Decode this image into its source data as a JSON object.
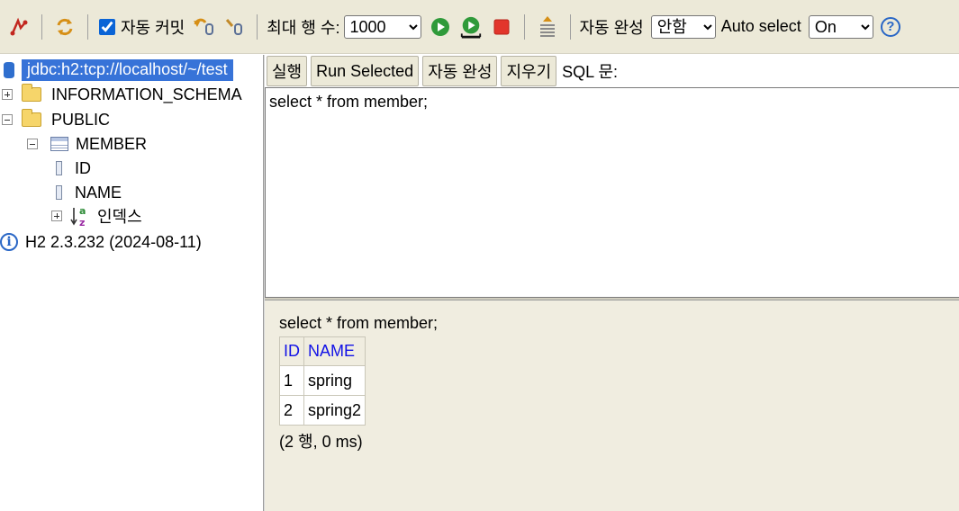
{
  "toolbar": {
    "autocommit_label": "자동 커밋",
    "autocommit_checked": true,
    "max_rows_label": "최대 행 수:",
    "max_rows_value": "1000",
    "autocomplete_label": "자동 완성",
    "autocomplete_value": "안함",
    "autoselect_label": "Auto select",
    "autoselect_value": "On",
    "help_symbol": "?"
  },
  "tree": {
    "connection": "jdbc:h2:tcp://localhost/~/test",
    "schemas": [
      {
        "name": "INFORMATION_SCHEMA",
        "expanded": false
      },
      {
        "name": "PUBLIC",
        "expanded": true
      }
    ],
    "table": {
      "name": "MEMBER",
      "columns": [
        "ID",
        "NAME"
      ],
      "indexes_label": "인덱스"
    },
    "version": "H2 2.3.232 (2024-08-11)"
  },
  "query_toolbar": {
    "run_label": "실행",
    "run_selected_label": "Run Selected",
    "autocomplete_label": "자동 완성",
    "clear_label": "지우기",
    "sql_label": "SQL 문:"
  },
  "editor": {
    "sql": "select * from member;"
  },
  "result": {
    "sql": "select * from member;",
    "columns": [
      "ID",
      "NAME"
    ],
    "rows": [
      [
        "1",
        "spring"
      ],
      [
        "2",
        "spring2"
      ]
    ],
    "summary": "(2 행, 0 ms)"
  },
  "colors": {
    "link": "#1212e6",
    "selection": "#3773d8",
    "panel": "#f0ede0"
  }
}
